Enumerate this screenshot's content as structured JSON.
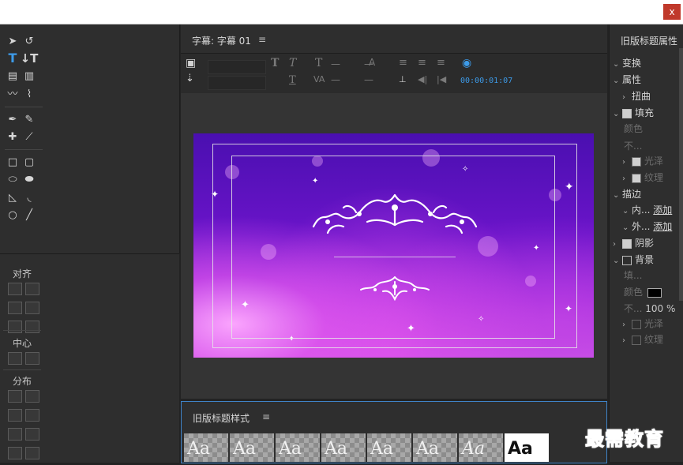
{
  "window": {
    "close_label": "x"
  },
  "title_panel": {
    "tab_title": "字幕: 字幕 01",
    "menu_glyph": "≡",
    "timecode": "00:00:01:07",
    "dash": "—"
  },
  "align": {
    "label": "对齐"
  },
  "center_section": {
    "label": "中心"
  },
  "distribute": {
    "label": "分布"
  },
  "styles": {
    "title": "旧版标题样式",
    "menu_glyph": "≡",
    "swatch_text": "Aa",
    "swatches": [
      "Aa",
      "Aa",
      "Aa",
      "Aa",
      "Aa",
      "Aa",
      "Aa",
      "Aa"
    ]
  },
  "properties": {
    "title": "旧版标题属性",
    "transform": "变换",
    "attributes": "属性",
    "distort": "扭曲",
    "fill": "填充",
    "color": "颜色",
    "opacity": "不...",
    "sheen": "光泽",
    "texture": "纹理",
    "stroke": "描边",
    "inner": "内...",
    "outer": "外...",
    "add": "添加",
    "shadow": "阴影",
    "background": "背景",
    "fill_type": "填...",
    "bg_opacity_value": "100 %"
  },
  "watermark": {
    "text": "最需教育"
  },
  "colors": {
    "accent": "#3d9be9",
    "close": "#c0392b",
    "watermark": "#1d3fd1"
  }
}
